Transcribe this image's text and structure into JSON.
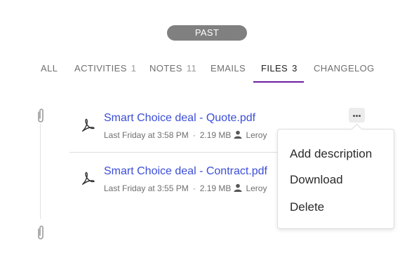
{
  "filter": {
    "past_label": "PAST"
  },
  "tabs": [
    {
      "label": "ALL",
      "count": ""
    },
    {
      "label": "ACTIVITIES",
      "count": "1"
    },
    {
      "label": "NOTES",
      "count": "11"
    },
    {
      "label": "EMAILS",
      "count": ""
    },
    {
      "label": "FILES",
      "count": "3"
    },
    {
      "label": "CHANGELOG",
      "count": ""
    }
  ],
  "active_tab": "FILES",
  "accent_color": "#6b1e9f",
  "link_color": "#3b4ed6",
  "files": [
    {
      "name": "Smart Choice deal - Quote.pdf",
      "date": "Last Friday at 3:58 PM",
      "size": "2.19 MB",
      "user": "Leroy",
      "icon": "pdf-icon"
    },
    {
      "name": "Smart Choice deal - Contract.pdf",
      "date": "Last Friday at 3:55 PM",
      "size": "2.19 MB",
      "user": "Leroy",
      "icon": "pdf-icon"
    }
  ],
  "menu": {
    "items": [
      "Add description",
      "Download",
      "Delete"
    ]
  },
  "icons": {
    "timeline": "paperclip-icon",
    "more": "more-options-icon",
    "user": "user-icon"
  }
}
